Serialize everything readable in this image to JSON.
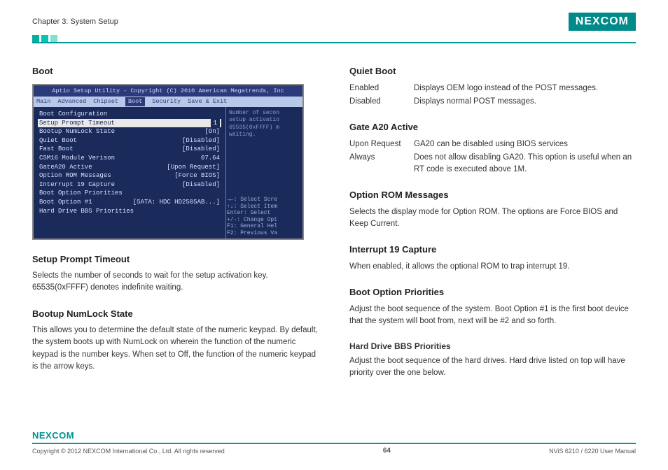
{
  "header": {
    "chapter": "Chapter 3: System Setup",
    "logo_text": "NEXCOM"
  },
  "left": {
    "title_boot": "Boot",
    "setup_prompt_title": "Setup Prompt Timeout",
    "setup_prompt_desc": "Selects the number of seconds to wait for the setup activation key. 65535(0xFFFF) denotes indefinite waiting.",
    "numlock_title": "Bootup NumLock State",
    "numlock_desc": "This allows you to determine the default state of the numeric keypad. By default, the system boots up with NumLock on wherein the function of the numeric keypad is the number keys. When set to Off, the function of the numeric keypad is the arrow keys."
  },
  "right": {
    "quiet_boot_title": "Quiet Boot",
    "quiet_enabled_key": "Enabled",
    "quiet_enabled_val": "Displays OEM logo instead of the POST messages.",
    "quiet_disabled_key": "Disabled",
    "quiet_disabled_val": "Displays normal POST messages.",
    "gatea20_title": "Gate A20 Active",
    "gatea20_upon_key": "Upon Request",
    "gatea20_upon_val": "GA20 can be disabled using BIOS services",
    "gatea20_always_key": "Always",
    "gatea20_always_val": "Does not allow disabling GA20. This option is useful when an RT code is executed above 1M.",
    "optrom_title": "Option ROM Messages",
    "optrom_desc": "Selects the display mode for Option ROM. The options are Force BIOS and Keep Current.",
    "int19_title": "Interrupt 19 Capture",
    "int19_desc": "When enabled, it allows the optional ROM to trap interrupt 19.",
    "bootprio_title": "Boot Option Priorities",
    "bootprio_desc": "Adjust the boot sequence of the system. Boot Option #1 is the first boot device that the system will boot from, next will be #2 and so forth.",
    "hdd_title": "Hard Drive BBS Priorities",
    "hdd_desc": "Adjust the boot sequence of the hard drives. Hard drive listed on top will have priority over the one below."
  },
  "bios": {
    "title": "Aptio Setup Utility - Copyright (C) 2010 American Megatrends, Inc",
    "tabs": [
      "Main",
      "Advanced",
      "Chipset",
      "Boot",
      "Security",
      "Save & Exit"
    ],
    "items": [
      {
        "label": "Boot Configuration",
        "val": ""
      },
      {
        "label": "Setup Prompt Timeout",
        "val": "1",
        "sel": true
      },
      {
        "label": "Bootup NumLock State",
        "val": "[On]"
      },
      {
        "label": "",
        "val": ""
      },
      {
        "label": "Quiet Boot",
        "val": "[Disabled]"
      },
      {
        "label": "Fast Boot",
        "val": "[Disabled]"
      },
      {
        "label": "",
        "val": ""
      },
      {
        "label": "CSM16 Module Verison",
        "val": "07.64"
      },
      {
        "label": "",
        "val": ""
      },
      {
        "label": "GateA20 Active",
        "val": "[Upon Request]"
      },
      {
        "label": "Option ROM Messages",
        "val": "[Force BIOS]"
      },
      {
        "label": "Interrupt 19 Capture",
        "val": "[Disabled]"
      },
      {
        "label": "",
        "val": ""
      },
      {
        "label": "Boot Option Priorities",
        "val": ""
      },
      {
        "label": "Boot Option #1",
        "val": "[SATA: HDC HD2505AB...]"
      },
      {
        "label": "",
        "val": ""
      },
      {
        "label": "Hard Drive BBS Priorities",
        "val": ""
      }
    ],
    "hint_top": "Number of secon\nsetup activatio\n65535(0xFFFF) m\nwaiting.",
    "hint_bottom": "→←: Select Scre\n↑↓: Select Item\nEnter: Select\n+/-: Change Opt\nF1: General Hel\nF2: Previous Va"
  },
  "footer": {
    "logo": "NEXCOM",
    "copyright": "Copyright © 2012 NEXCOM International Co., Ltd. All rights reserved",
    "page": "64",
    "doc": "NViS 6210 / 6220 User Manual"
  }
}
